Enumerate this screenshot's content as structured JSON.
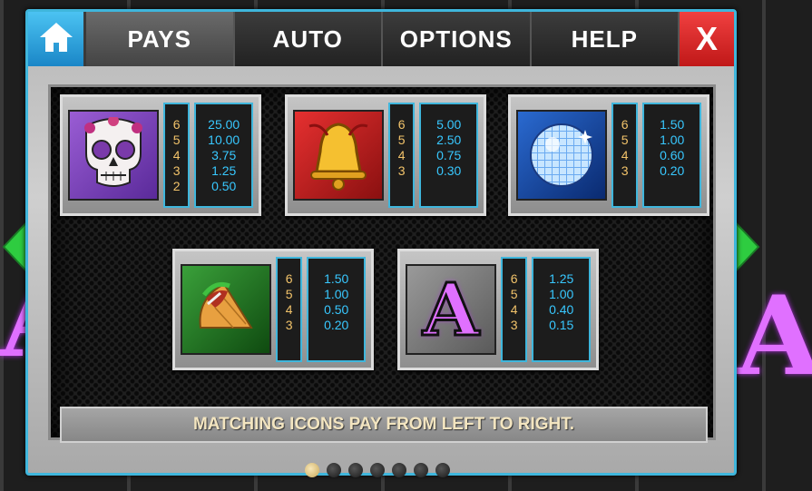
{
  "nav": {
    "tabs": [
      {
        "label": "PAYS",
        "active": true
      },
      {
        "label": "AUTO",
        "active": false
      },
      {
        "label": "OPTIONS",
        "active": false
      },
      {
        "label": "HELP",
        "active": false
      }
    ],
    "close_label": "X",
    "home_icon": "home-icon"
  },
  "paytable": [
    {
      "symbol": "sugar-skull",
      "counts": [
        "6",
        "5",
        "4",
        "3",
        "2"
      ],
      "values": [
        "25.00",
        "10.00",
        "3.75",
        "1.25",
        "0.50"
      ]
    },
    {
      "symbol": "bell",
      "counts": [
        "6",
        "5",
        "4",
        "3"
      ],
      "values": [
        "5.00",
        "2.50",
        "0.75",
        "0.30"
      ]
    },
    {
      "symbol": "disco-ball",
      "counts": [
        "6",
        "5",
        "4",
        "3"
      ],
      "values": [
        "1.50",
        "1.00",
        "0.60",
        "0.20"
      ]
    },
    {
      "symbol": "taco",
      "counts": [
        "6",
        "5",
        "4",
        "3"
      ],
      "values": [
        "1.50",
        "1.00",
        "0.50",
        "0.20"
      ]
    },
    {
      "symbol": "letter-a",
      "label": "A",
      "counts": [
        "6",
        "5",
        "4",
        "3"
      ],
      "values": [
        "1.25",
        "1.00",
        "0.40",
        "0.15"
      ]
    }
  ],
  "footer": {
    "text": "MATCHING ICONS PAY FROM LEFT TO RIGHT."
  },
  "pagination": {
    "total": 7,
    "current": 1
  },
  "colors": {
    "accent": "#3fb6dc",
    "close": "#d82020",
    "value_text": "#38c8ff",
    "count_text": "#f2c36a",
    "arrow": "#2ecc40"
  }
}
